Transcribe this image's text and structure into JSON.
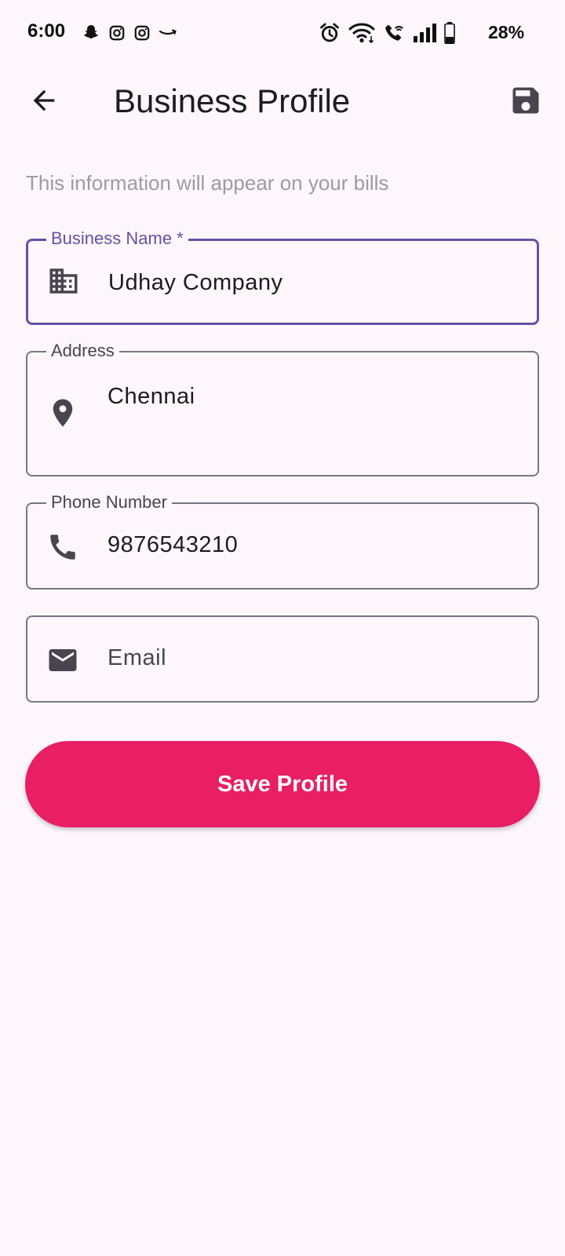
{
  "status_bar": {
    "time": "6:00",
    "battery": "28%",
    "left_icons": [
      "snapchat-icon",
      "instagram-icon",
      "instagram-icon",
      "amazon-icon"
    ],
    "right_icons": [
      "alarm-icon",
      "wifi-icon",
      "wifi-call-icon",
      "signal-icon",
      "battery-icon"
    ]
  },
  "app_bar": {
    "title": "Business Profile",
    "back_icon": "arrow-back-icon",
    "save_icon": "save-icon"
  },
  "subtitle": "This information will appear on your bills",
  "form": {
    "business_name": {
      "label": "Business Name *",
      "value": "Udhay Company",
      "icon": "business-icon",
      "focused": true
    },
    "address": {
      "label": "Address",
      "value": "Chennai",
      "icon": "location-pin-icon"
    },
    "phone": {
      "label": "Phone Number",
      "value": "9876543210",
      "icon": "phone-icon"
    },
    "email": {
      "placeholder": "Email",
      "value": "",
      "icon": "email-icon"
    }
  },
  "save_button_label": "Save Profile",
  "colors": {
    "background": "#fdf7fc",
    "primary": "#6750a4",
    "button": "#e91e63",
    "outline": "#7a757f",
    "icon": "#49454f"
  }
}
